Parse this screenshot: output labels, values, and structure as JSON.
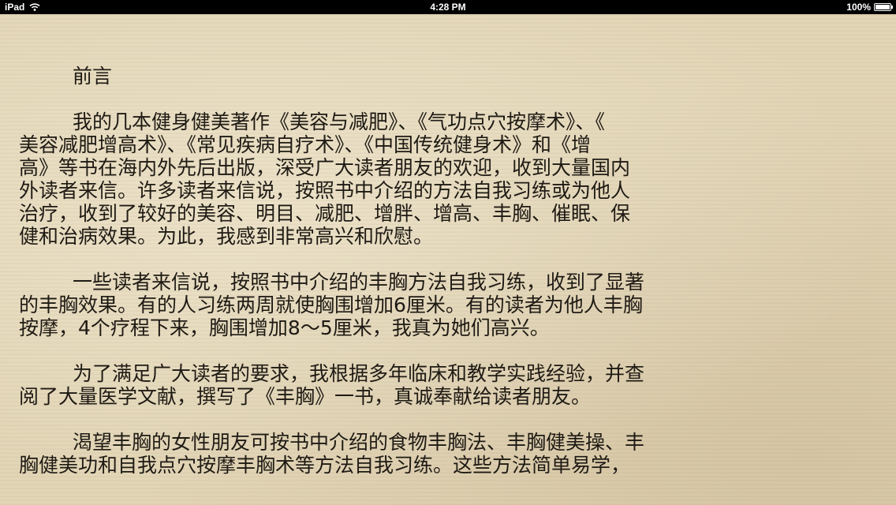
{
  "status_bar": {
    "device": "iPad",
    "time": "4:28 PM",
    "battery": "100%",
    "wifi_icon": "wifi-icon",
    "battery_icon": "battery-icon"
  },
  "reader": {
    "heading": "前言",
    "paragraphs": [
      {
        "lines": [
          "我的几本健身健美著作《美容与减肥》、《气功点穴按摩术》、《",
          "美容减肥增高术》、《常见疾病自疗术》、《中国传统健身术》和《增",
          "高》等书在海内外先后出版，深受广大读者朋友的欢迎，收到大量国内",
          "外读者来信。许多读者来信说，按照书中介绍的方法自我习练或为他人",
          "治疗，收到了较好的美容、明目、减肥、增胖、增高、丰胸、催眠、保",
          "健和治病效果。为此，我感到非常高兴和欣慰。"
        ]
      },
      {
        "lines": [
          "一些读者来信说，按照书中介绍的丰胸方法自我习练，收到了显著",
          "的丰胸效果。有的人习练两周就使胸围增加6厘米。有的读者为他人丰胸",
          "按摩，4个疗程下来，胸围增加8～5厘米，我真为她们高兴。"
        ]
      },
      {
        "lines": [
          "为了满足广大读者的要求，我根据多年临床和教学实践经验，并查",
          "阅了大量医学文献，撰写了《丰胸》一书，真诚奉献给读者朋友。"
        ]
      },
      {
        "lines": [
          "渴望丰胸的女性朋友可按书中介绍的食物丰胸法、丰胸健美操、丰",
          "胸健美功和自我点穴按摩丰胸术等方法自我习练。这些方法简单易学，"
        ]
      }
    ]
  }
}
